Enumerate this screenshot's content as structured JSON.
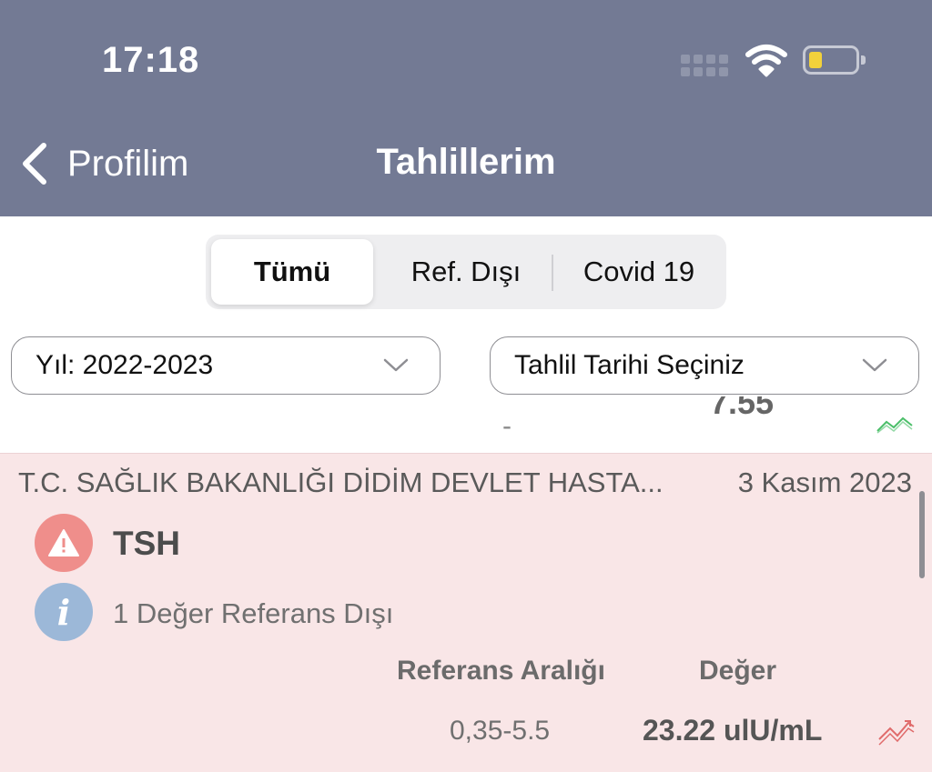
{
  "status_bar": {
    "time": "17:18",
    "icons": [
      "cellular-signal-icon",
      "wifi-icon",
      "battery-icon"
    ],
    "battery_color": "#f2d13b"
  },
  "nav": {
    "back_label": "Profilim",
    "title": "Tahlillerim",
    "background": "#737a94"
  },
  "segments": {
    "items": [
      {
        "label": "Tümü",
        "selected": true
      },
      {
        "label": "Ref. Dışı",
        "selected": false
      },
      {
        "label": "Covid 19",
        "selected": false
      }
    ]
  },
  "filters": {
    "year": "Yıl: 2022-2023",
    "date": "Tahlil Tarihi Seçiniz"
  },
  "partial_row": {
    "dash": "-",
    "value": "7.55"
  },
  "result_card": {
    "hospital": "T.C. SAĞLIK BAKANLIĞI DİDİM DEVLET HASTA...",
    "date": "3 Kasım 2023",
    "test_name": "TSH",
    "info_icon_glyph": "i",
    "note": "1 Değer Referans Dışı",
    "col_ref_header": "Referans Aralığı",
    "col_value_header": "Değer",
    "ref_range": "0,35-5.5",
    "value": "23.22 ulU/mL",
    "background": "#f9e6e7",
    "warning_color": "#ef8e8b",
    "info_color": "#9cb8d8",
    "trend_out_of_range_color": "#e06b6b",
    "trend_in_range_color": "#4cbf6a"
  }
}
